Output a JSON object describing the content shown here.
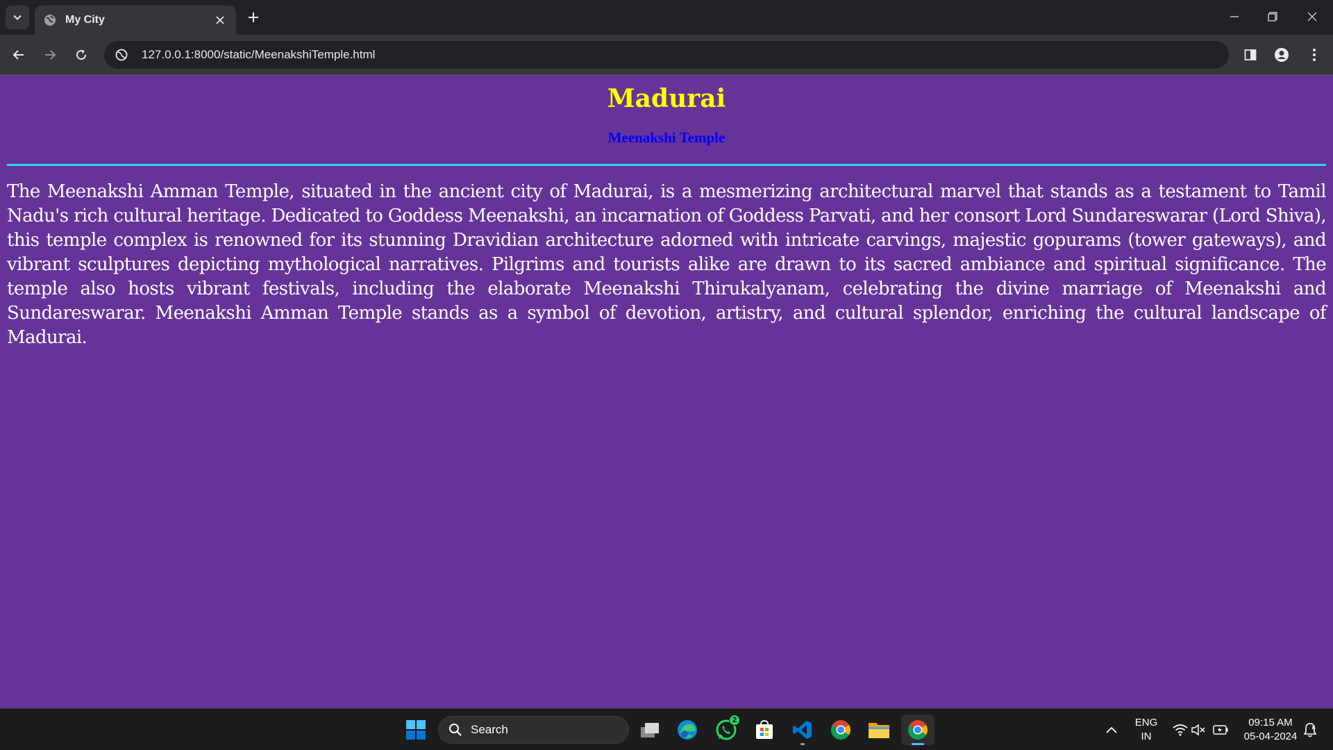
{
  "browser": {
    "tab_title": "My City",
    "url": "127.0.0.1:8000/static/MeenakshiTemple.html"
  },
  "page": {
    "heading": "Madurai",
    "subheading": "Meenakshi Temple",
    "paragraph": "The Meenakshi Amman Temple, situated in the ancient city of Madurai, is a mesmerizing architectural marvel that stands as a testament to Tamil Nadu's rich cultural heritage. Dedicated to Goddess Meenakshi, an incarnation of Goddess Parvati, and her consort Lord Sundareswarar (Lord Shiva), this temple complex is renowned for its stunning Dravidian architecture adorned with intricate carvings, majestic gopurams (tower gateways), and vibrant sculptures depicting mythological narratives. Pilgrims and tourists alike are drawn to its sacred ambiance and spiritual significance. The temple also hosts vibrant festivals, including the elaborate Meenakshi Thirukalyanam, celebrating the divine marriage of Meenakshi and Sundareswarar. Meenakshi Amman Temple stands as a symbol of devotion, artistry, and cultural splendor, enriching the cultural landscape of Madurai.",
    "colors": {
      "background": "#663399",
      "heading": "#ffff00",
      "subheading": "#0000ff",
      "rule": "#29d3f3",
      "text": "#ffffff"
    }
  },
  "taskbar": {
    "search_label": "Search",
    "whatsapp_badge": "2",
    "language": "ENG",
    "region": "IN",
    "time": "09:15 AM",
    "date": "05-04-2024"
  },
  "icons": [
    "tab-search-icon",
    "globe-icon",
    "close-icon",
    "plus-icon",
    "minimize-icon",
    "restore-icon",
    "back-arrow-icon",
    "forward-arrow-icon",
    "reload-icon",
    "site-info-icon",
    "side-panel-icon",
    "profile-icon",
    "more-vert-icon",
    "windows-start-icon",
    "search-icon",
    "task-view-icon",
    "edge-icon",
    "whatsapp-icon",
    "store-icon",
    "vscode-icon",
    "chrome-icon",
    "file-explorer-icon",
    "chevron-up-icon",
    "wifi-icon",
    "speaker-muted-icon",
    "battery-icon",
    "notification-icon"
  ]
}
